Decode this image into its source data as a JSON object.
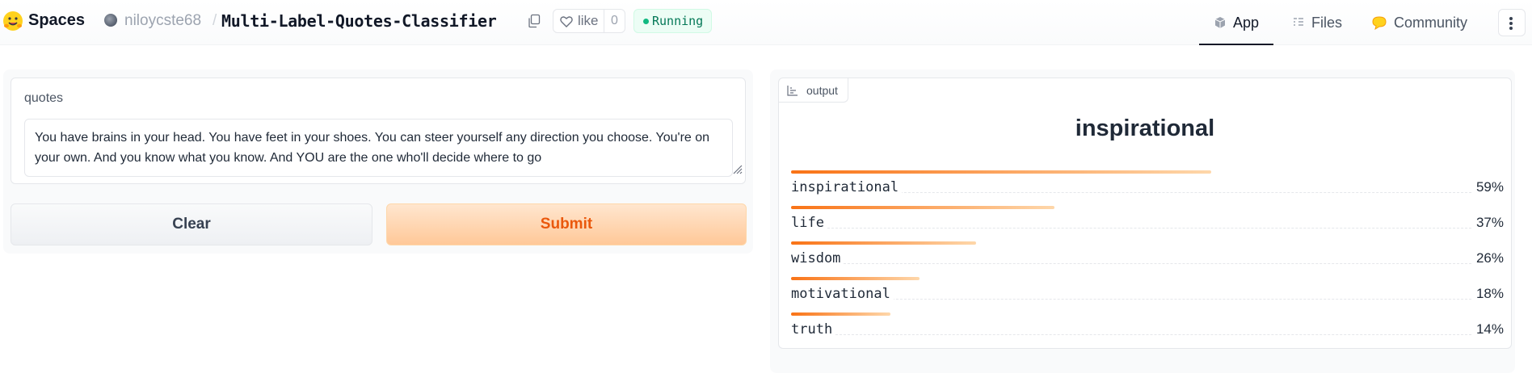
{
  "header": {
    "brand": "Spaces",
    "owner": "niloycste68",
    "separator": "/",
    "repo": "Multi-Label-Quotes-Classifier",
    "like_label": "like",
    "like_count": "0",
    "status": "Running",
    "tabs": [
      {
        "label": "App",
        "icon": "cube-icon"
      },
      {
        "label": "Files",
        "icon": "files-icon"
      },
      {
        "label": "Community",
        "icon": "community-icon"
      }
    ]
  },
  "input": {
    "label": "quotes",
    "value": "You have brains in your head. You have feet in your shoes. You can steer yourself any direction you choose. You're on your own. And you know what you know. And YOU are the one who'll decide where to go"
  },
  "buttons": {
    "clear": "Clear",
    "submit": "Submit"
  },
  "output": {
    "tag": "output",
    "top_label": "inspirational",
    "confidences": [
      {
        "label": "inspirational",
        "value": 0.59,
        "pct": "59%"
      },
      {
        "label": "life",
        "value": 0.37,
        "pct": "37%"
      },
      {
        "label": "wisdom",
        "value": 0.26,
        "pct": "26%"
      },
      {
        "label": "motivational",
        "value": 0.18,
        "pct": "18%"
      },
      {
        "label": "truth",
        "value": 0.14,
        "pct": "14%"
      }
    ]
  },
  "colors": {
    "accent": "#f97316",
    "status_green": "#10b981"
  }
}
